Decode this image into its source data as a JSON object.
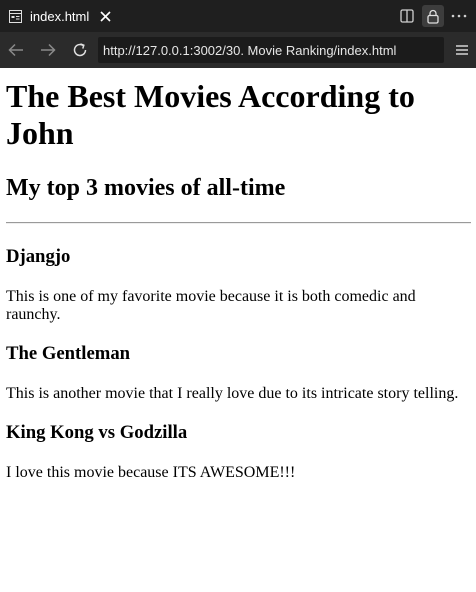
{
  "tab": {
    "title": "index.html"
  },
  "navbar": {
    "url": "http://127.0.0.1:3002/30. Movie Ranking/index.html"
  },
  "page": {
    "heading": "The Best Movies According to John",
    "subheading": "My top 3 movies of all-time",
    "movies": [
      {
        "title": "Djangjo",
        "description": "This is one of my favorite movie because it is both comedic and raunchy."
      },
      {
        "title": "The Gentleman",
        "description": "This is another movie that I really love due to its intricate story telling."
      },
      {
        "title": "King Kong vs Godzilla",
        "description": "I love this movie because ITS AWESOME!!!"
      }
    ]
  },
  "colors": {
    "tabbar_bg": "#1f1f1f",
    "navbar_bg": "#2b2b2b",
    "urlbox_bg": "#1b1b1b",
    "page_bg": "#ffffff"
  }
}
